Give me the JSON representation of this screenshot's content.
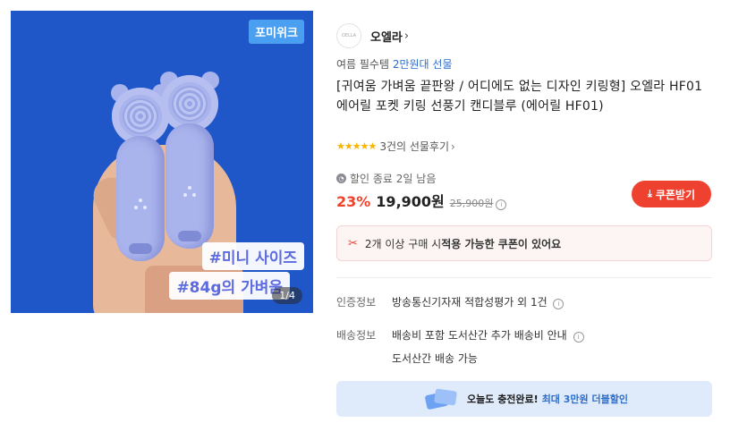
{
  "image": {
    "badge": "포미위크",
    "hashtags": [
      "#미니 사이즈",
      "#84g의 가벼움"
    ],
    "page_indicator": "1/4"
  },
  "seller": {
    "logo_text": "OELLA",
    "name": "오엘라"
  },
  "category": {
    "prefix": "여름 필수템",
    "accent": "2만원대 선물"
  },
  "product": {
    "title": "[귀여움 가벼움 끝판왕 / 어디에도 없는 디자인 키링형] 오엘라 HF01 에어릴 포켓 키링 선풍기 캔디블루 (에어릴 HF01)",
    "review_count": "3건의 선물후기",
    "rating_stars": 5
  },
  "pricing": {
    "discount_info": "할인 종료 2일 남음",
    "discount_rate": "23%",
    "sale_price": "19,900원",
    "original_price": "25,900원",
    "coupon_button": "쿠폰받기"
  },
  "coupon_notice": {
    "text_prefix": "2개 이상 구매 시 ",
    "text_bold": "적용 가능한 쿠폰이 있어요"
  },
  "info": {
    "certification_label": "인증정보",
    "certification_value": "방송통신기자재 적합성평가 외 1건",
    "shipping_label": "배송정보",
    "shipping_value": "배송비 포함 도서산간 추가 배송비 안내",
    "shipping_value2": "도서산간 배송 가능"
  },
  "banner": {
    "text_bold": "오늘도 충전완료!",
    "text_accent": "최대 3만원 더블할인"
  },
  "colors": {
    "accent_blue": "#2c6ecb",
    "sale_red": "#f0412b",
    "image_background": "#1f57c9",
    "fan_lavender": "#a9b3ec"
  }
}
